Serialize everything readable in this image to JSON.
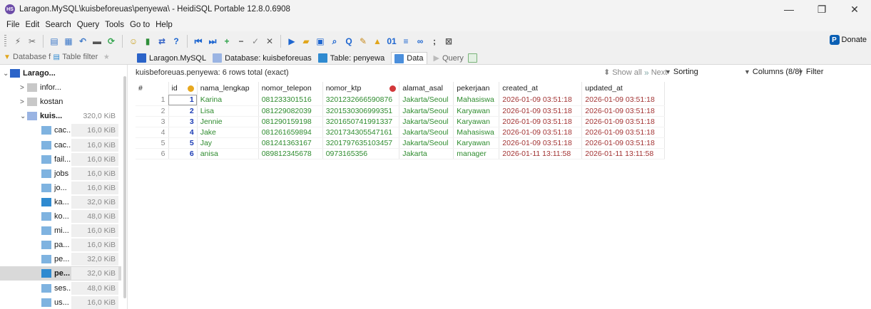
{
  "window": {
    "app_icon": "HS",
    "title": "Laragon.MySQL\\kuisbeforeuas\\penyewa\\ - HeidiSQL Portable 12.8.0.6908",
    "controls": [
      "—",
      "❐",
      "✕"
    ]
  },
  "menu": [
    "File",
    "Edit",
    "Search",
    "Query",
    "Tools",
    "Go to",
    "Help"
  ],
  "toolbar": {
    "icons": [
      {
        "name": "connect-icon",
        "glyph": "⚡",
        "color": "#6a6a6a"
      },
      {
        "name": "disconnect-icon",
        "glyph": "✂",
        "color": "#6a6a6a"
      },
      {
        "name": "copy-icon",
        "glyph": "▤",
        "color": "#3c78c8"
      },
      {
        "name": "paste-icon",
        "glyph": "▦",
        "color": "#3c78c8"
      },
      {
        "name": "undo-icon",
        "glyph": "↶",
        "color": "#3c78c8"
      },
      {
        "name": "print-icon",
        "glyph": "▬",
        "color": "#555555"
      },
      {
        "name": "refresh-icon",
        "glyph": "⟳",
        "color": "#2fa34a"
      },
      {
        "name": "user-manager-icon",
        "glyph": "☺",
        "color": "#c9a11d"
      },
      {
        "name": "import-icon",
        "glyph": "▮",
        "color": "#2f8f3a"
      },
      {
        "name": "export-icon",
        "glyph": "⇄",
        "color": "#2b5cc4"
      },
      {
        "name": "help-icon",
        "glyph": "?",
        "color": "#1e66d0"
      },
      {
        "name": "first-record-icon",
        "glyph": "⏮",
        "color": "#1e66d0"
      },
      {
        "name": "last-record-icon",
        "glyph": "⏭",
        "color": "#1e66d0"
      },
      {
        "name": "add-record-icon",
        "glyph": "+",
        "color": "#2fa34a"
      },
      {
        "name": "delete-record-icon",
        "glyph": "−",
        "color": "#555555"
      },
      {
        "name": "post-icon",
        "glyph": "✓",
        "color": "#888888"
      },
      {
        "name": "cancel-icon",
        "glyph": "✕",
        "color": "#555555"
      },
      {
        "name": "run-icon",
        "glyph": "▶",
        "color": "#1e66d0"
      },
      {
        "name": "folder-icon",
        "glyph": "▰",
        "color": "#e1a61c"
      },
      {
        "name": "save-icon",
        "glyph": "▣",
        "color": "#1e66d0"
      },
      {
        "name": "search-icon",
        "glyph": "⌕",
        "color": "#1e66d0"
      },
      {
        "name": "find-icon",
        "glyph": "Q",
        "color": "#1e66d0"
      },
      {
        "name": "format-icon",
        "glyph": "✎",
        "color": "#c88a1c"
      },
      {
        "name": "warning-icon",
        "glyph": "▲",
        "color": "#e1a61c"
      },
      {
        "name": "binary-icon",
        "glyph": "01",
        "color": "#1e66d0"
      },
      {
        "name": "wrap-icon",
        "glyph": "≡",
        "color": "#1e66d0"
      },
      {
        "name": "link-icon",
        "glyph": "∞",
        "color": "#1e66d0"
      },
      {
        "name": "semicolon-icon",
        "glyph": ";",
        "color": "#333333"
      },
      {
        "name": "close-tab-icon",
        "glyph": "⊠",
        "color": "#555555"
      }
    ],
    "donate_label": "Donate"
  },
  "tabs_left": {
    "database_filter": "Database f",
    "table_filter": "Table filter"
  },
  "tabs": [
    {
      "label": "Laragon.MySQL",
      "color": "#2b63c8"
    },
    {
      "label": "Database: kuisbeforeuas",
      "color": "#9ab4e3"
    },
    {
      "label": "Table: penyewa",
      "color": "#2f8ad0"
    },
    {
      "label": "Data",
      "color": "#4b8fdc"
    },
    {
      "label": "Query",
      "color": "#9bb7d7"
    }
  ],
  "sidebar": {
    "items": [
      {
        "name": "Larago...",
        "level": 0,
        "expander": "⌄",
        "bold": true,
        "size": "",
        "icon_color": "#2b63c8"
      },
      {
        "name": "infor...",
        "level": 1,
        "expander": ">",
        "bold": false,
        "size": "",
        "icon_color": "#c8c8c8"
      },
      {
        "name": "kostan",
        "level": 1,
        "expander": ">",
        "bold": false,
        "size": "",
        "icon_color": "#c8c8c8"
      },
      {
        "name": "kuis...",
        "level": 1,
        "expander": "⌄",
        "bold": true,
        "size": "320,0 KiB",
        "icon_color": "#9ab4e3"
      },
      {
        "name": "cac...",
        "level": 2,
        "expander": "",
        "bold": false,
        "size": "16,0 KiB",
        "icon_color": "#7fb3e0"
      },
      {
        "name": "cac...",
        "level": 2,
        "expander": "",
        "bold": false,
        "size": "16,0 KiB",
        "icon_color": "#7fb3e0"
      },
      {
        "name": "fail...",
        "level": 2,
        "expander": "",
        "bold": false,
        "size": "16,0 KiB",
        "icon_color": "#7fb3e0"
      },
      {
        "name": "jobs",
        "level": 2,
        "expander": "",
        "bold": false,
        "size": "16,0 KiB",
        "icon_color": "#7fb3e0"
      },
      {
        "name": "jo...",
        "level": 2,
        "expander": "",
        "bold": false,
        "size": "16,0 KiB",
        "icon_color": "#7fb3e0"
      },
      {
        "name": "ka...",
        "level": 2,
        "expander": "",
        "bold": false,
        "size": "32,0 KiB",
        "icon_color": "#2f8ad0"
      },
      {
        "name": "ko...",
        "level": 2,
        "expander": "",
        "bold": false,
        "size": "48,0 KiB",
        "icon_color": "#7fb3e0"
      },
      {
        "name": "mi...",
        "level": 2,
        "expander": "",
        "bold": false,
        "size": "16,0 KiB",
        "icon_color": "#7fb3e0"
      },
      {
        "name": "pa...",
        "level": 2,
        "expander": "",
        "bold": false,
        "size": "16,0 KiB",
        "icon_color": "#7fb3e0"
      },
      {
        "name": "pe...",
        "level": 2,
        "expander": "",
        "bold": false,
        "size": "32,0 KiB",
        "icon_color": "#7fb3e0"
      },
      {
        "name": "pe...",
        "level": 2,
        "expander": "",
        "bold": true,
        "size": "32,0 KiB",
        "icon_color": "#2f8ad0",
        "selected": true
      },
      {
        "name": "ses...",
        "level": 2,
        "expander": "",
        "bold": false,
        "size": "48,0 KiB",
        "icon_color": "#7fb3e0"
      },
      {
        "name": "us...",
        "level": 2,
        "expander": "",
        "bold": false,
        "size": "16,0 KiB",
        "icon_color": "#7fb3e0"
      }
    ]
  },
  "main": {
    "info": "kuisbeforeuas.penyewa: 6 rows total (exact)",
    "next_label": "Next",
    "show_all_label": "Show all",
    "sorting_label": "Sorting",
    "columns_label": "Columns (8/8)",
    "filter_label": "Filter"
  },
  "grid": {
    "columns": [
      "#",
      "id",
      "nama_lengkap",
      "nomor_telepon",
      "nomor_ktp",
      "alamat_asal",
      "pekerjaan",
      "created_at",
      "updated_at"
    ],
    "rows": [
      [
        "1",
        "1",
        "Karina",
        "081233301516",
        "3201232666590876",
        "Jakarta/Seoul",
        "Mahasiswa",
        "2026-01-09 03:51:18",
        "2026-01-09 03:51:18"
      ],
      [
        "2",
        "2",
        "Lisa",
        "081229082039",
        "3201530306999351",
        "Jakarta/Seoul",
        "Karyawan",
        "2026-01-09 03:51:18",
        "2026-01-09 03:51:18"
      ],
      [
        "3",
        "3",
        "Jennie",
        "081290159198",
        "3201650741991337",
        "Jakarta/Seoul",
        "Karyawan",
        "2026-01-09 03:51:18",
        "2026-01-09 03:51:18"
      ],
      [
        "4",
        "4",
        "Jake",
        "081261659894",
        "3201734305547161",
        "Jakarta/Seoul",
        "Mahasiswa",
        "2026-01-09 03:51:18",
        "2026-01-09 03:51:18"
      ],
      [
        "5",
        "5",
        "Jay",
        "081241363167",
        "3201797635103457",
        "Jakarta/Seoul",
        "Karyawan",
        "2026-01-09 03:51:18",
        "2026-01-09 03:51:18"
      ],
      [
        "6",
        "6",
        "anisa",
        "089812345678",
        "0973165356",
        "Jakarta",
        "manager",
        "2026-01-11 13:11:58",
        "2026-01-11 13:11:58"
      ]
    ]
  }
}
